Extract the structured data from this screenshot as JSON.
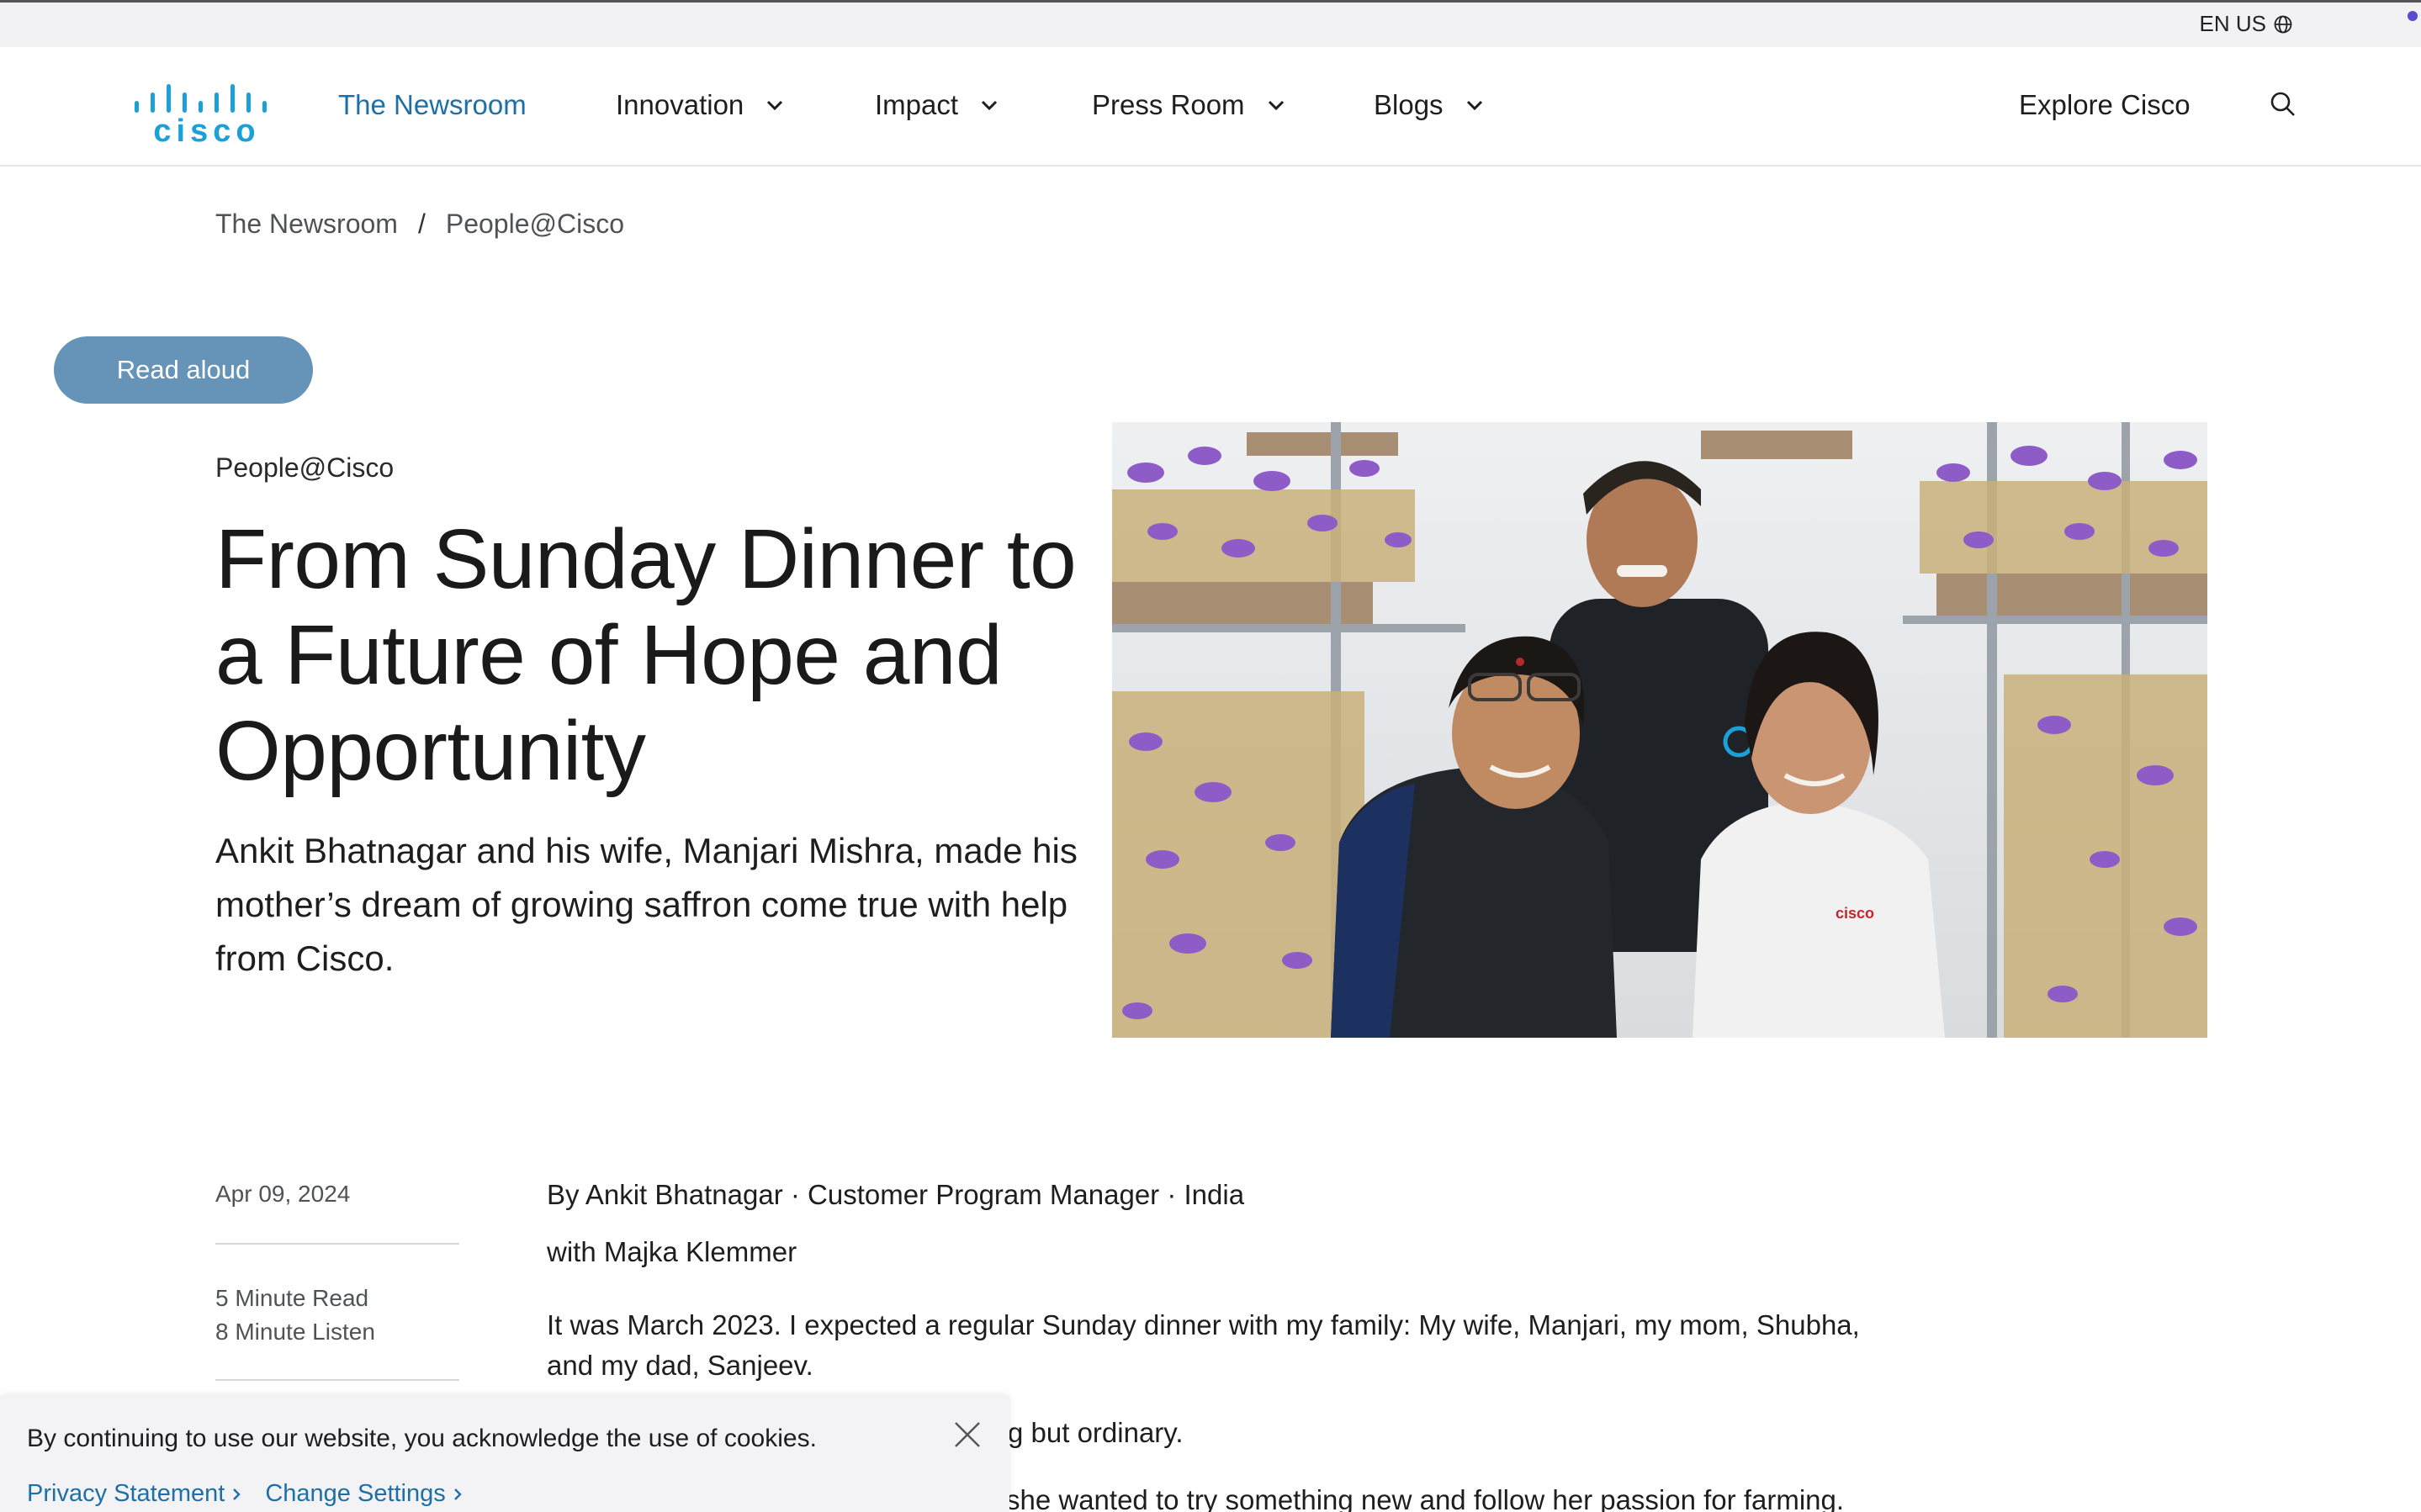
{
  "utility": {
    "language": "EN US",
    "globe_icon": "globe-icon"
  },
  "header": {
    "brand": "cisco",
    "nav": [
      {
        "label": "The Newsroom",
        "active": true
      },
      {
        "label": "Innovation",
        "dropdown": true
      },
      {
        "label": "Impact",
        "dropdown": true
      },
      {
        "label": "Press Room",
        "dropdown": true
      },
      {
        "label": "Blogs",
        "dropdown": true
      }
    ],
    "explore": "Explore Cisco",
    "search_icon": "search-icon"
  },
  "breadcrumb": {
    "items": [
      "The Newsroom",
      "People@Cisco"
    ],
    "separator": "/"
  },
  "read_aloud": "Read aloud",
  "hero": {
    "eyebrow": "People@Cisco",
    "headline": "From Sunday Dinner to a Future of Hope and Opportunity",
    "dek": "Ankit Bhatnagar and his wife, Manjari Mishra, made his mother’s dream of growing saffron come true with help from Cisco.",
    "image_logo_text": "cisco"
  },
  "meta": {
    "date": "Apr 09, 2024",
    "read_time": "5 Minute Read",
    "listen_time": "8 Minute Listen"
  },
  "article": {
    "byline": "By Ankit Bhatnagar · Customer Program Manager · India",
    "with": "with Majka Klemmer",
    "p1": "It was March 2023. I expected a regular Sunday dinner with my family: My wife, Manjari, my mom, Shubha, and my dad, Sanjeev.",
    "p2_visible": "g but ordinary.",
    "p3_visible": "she wanted to try something new and follow her passion for farming."
  },
  "cookie": {
    "text": "By continuing to use our website, you acknowledge the use of cookies.",
    "privacy": "Privacy Statement",
    "settings": "Change Settings"
  },
  "colors": {
    "brand_blue": "#1e6fa6",
    "read_aloud_bg": "#6594b8",
    "saffron_purple": "#8e5cc7"
  }
}
